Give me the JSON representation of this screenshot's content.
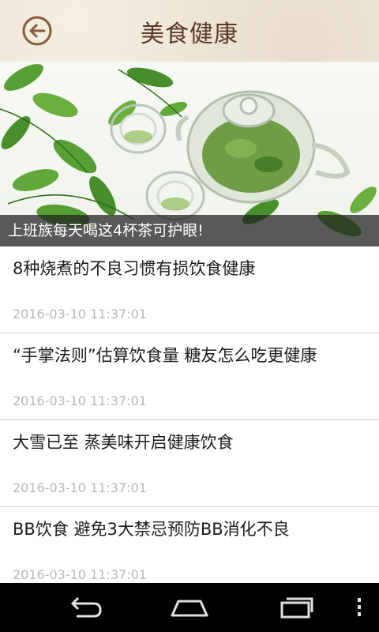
{
  "header": {
    "title": "美食健康",
    "back_icon": "back-arrow-circle-icon",
    "accent_color": "#8a5a3a"
  },
  "hero": {
    "caption": "上班族每天喝这4杯茶可护眼!"
  },
  "news": [
    {
      "title": "8种烧煮的不良习惯有损饮食健康",
      "time": "2016-03-10 11:37:01"
    },
    {
      "title": "“手掌法则”估算饮食量 糖友怎么吃更健康",
      "time": "2016-03-10 11:37:01"
    },
    {
      "title": "大雪已至 蒸美味开启健康饮食",
      "time": "2016-03-10 11:37:01"
    },
    {
      "title": "BB饮食 避免3大禁忌预防BB消化不良",
      "time": "2016-03-10 11:37:01"
    }
  ],
  "system_nav": {
    "back_icon": "android-back-icon",
    "home_icon": "android-home-icon",
    "recents_icon": "android-recents-icon",
    "menu_icon": "android-menu-icon"
  }
}
